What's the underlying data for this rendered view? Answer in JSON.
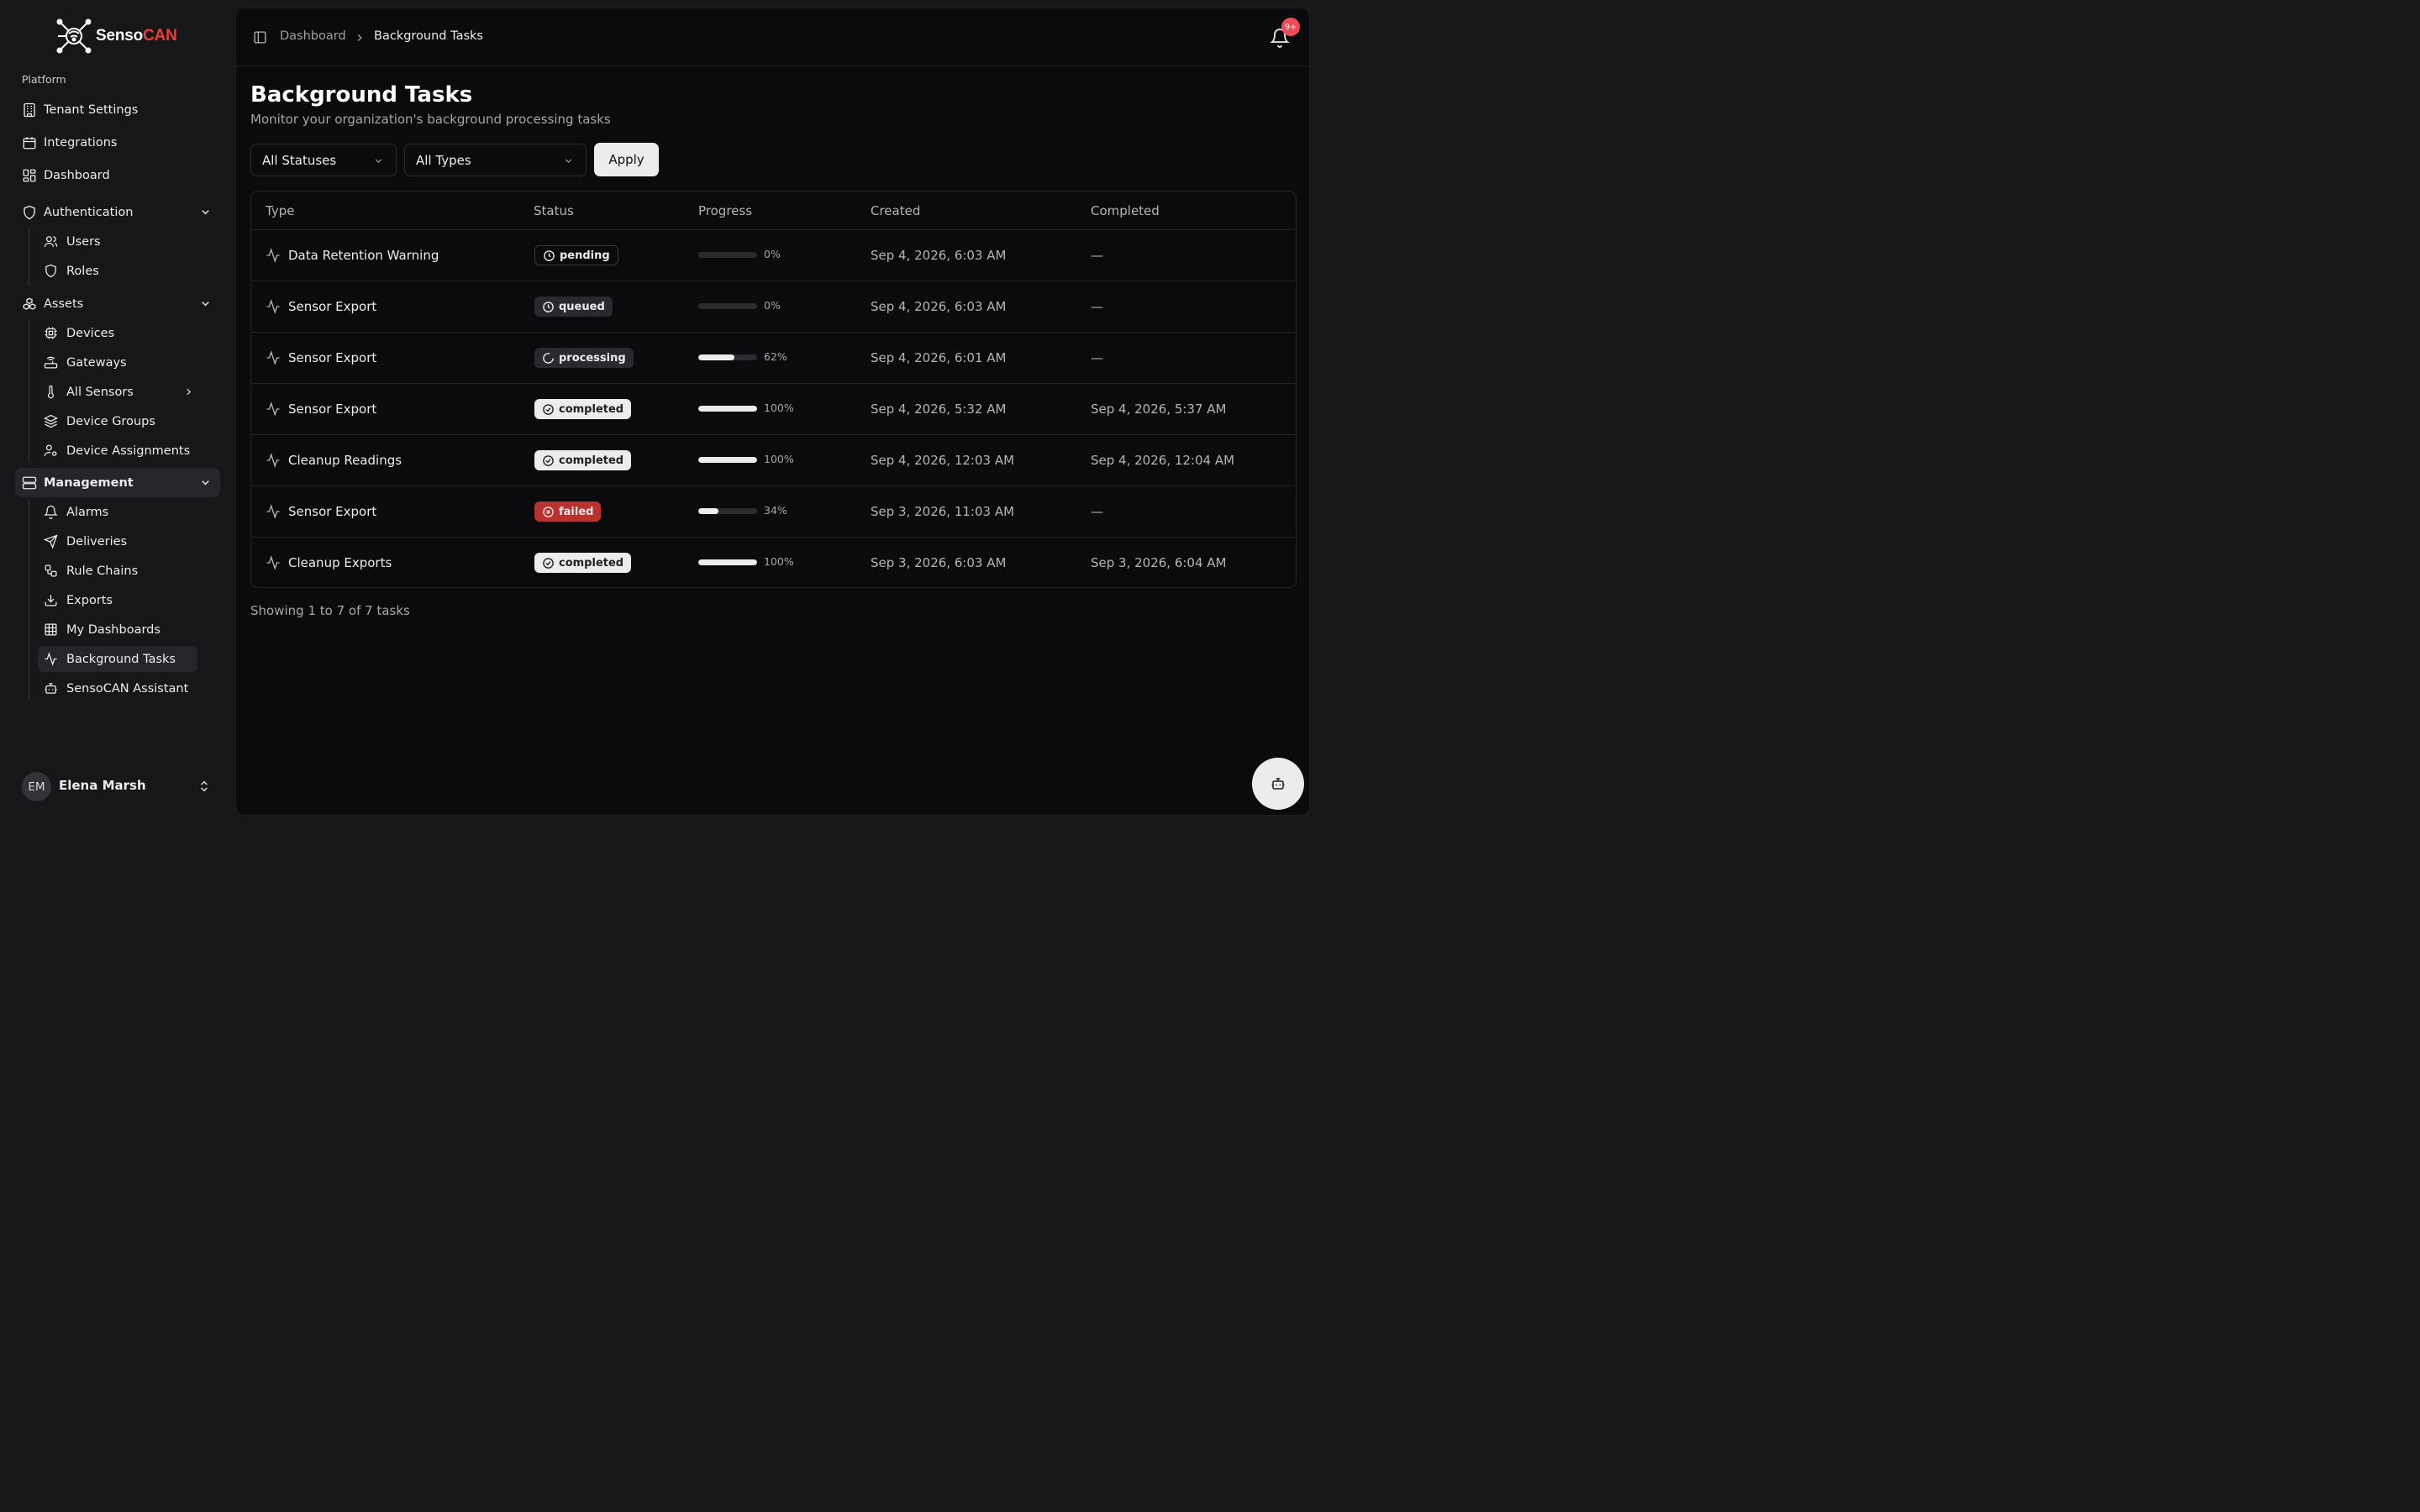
{
  "app": {
    "logo_part1": "Senso",
    "logo_part2": "CAN",
    "brand_color": "#ef3b3b"
  },
  "sidebar": {
    "group_label": "Platform",
    "top_items": [
      {
        "label": "Tenant Settings",
        "icon": "building-icon"
      },
      {
        "label": "Integrations",
        "icon": "calendar-icon"
      },
      {
        "label": "Dashboard",
        "icon": "dashboard-icon"
      }
    ],
    "authentication": {
      "label": "Authentication",
      "icon": "shield-icon",
      "children": [
        {
          "label": "Users",
          "icon": "users-icon"
        },
        {
          "label": "Roles",
          "icon": "shield-icon"
        }
      ]
    },
    "assets": {
      "label": "Assets",
      "icon": "boxes-icon",
      "children": [
        {
          "label": "Devices",
          "icon": "cpu-icon"
        },
        {
          "label": "Gateways",
          "icon": "router-icon"
        },
        {
          "label": "All Sensors",
          "icon": "thermometer-icon"
        },
        {
          "label": "Device Groups",
          "icon": "layers-icon"
        },
        {
          "label": "Device Assignments",
          "icon": "user-cog-icon"
        }
      ]
    },
    "management": {
      "label": "Management",
      "icon": "server-icon",
      "children": [
        {
          "label": "Alarms",
          "icon": "bell-icon"
        },
        {
          "label": "Deliveries",
          "icon": "send-icon"
        },
        {
          "label": "Rule Chains",
          "icon": "workflow-icon"
        },
        {
          "label": "Exports",
          "icon": "download-icon"
        },
        {
          "label": "My Dashboards",
          "icon": "grid-icon"
        },
        {
          "label": "Background Tasks",
          "icon": "activity-icon"
        },
        {
          "label": "SensoCAN Assistant",
          "icon": "bot-icon"
        }
      ]
    },
    "user": {
      "initials": "EM",
      "name": "Elena Marsh"
    }
  },
  "header": {
    "breadcrumb": [
      "Dashboard",
      "Background Tasks"
    ],
    "notification_badge": "9+",
    "badge_color": "#ef4a55"
  },
  "page": {
    "title": "Background Tasks",
    "subtitle": "Monitor your organization's background processing tasks",
    "filters": {
      "status_value": "All Statuses",
      "type_value": "All Types",
      "apply_label": "Apply"
    },
    "table": {
      "columns": [
        "Type",
        "Status",
        "Progress",
        "Created",
        "Completed"
      ],
      "rows": [
        {
          "type": "Data Retention Warning",
          "status": "pending",
          "progress": 0,
          "progress_label": "0%",
          "created": "Sep 4, 2026, 6:03 AM",
          "completed": "—"
        },
        {
          "type": "Sensor Export",
          "status": "queued",
          "progress": 0,
          "progress_label": "0%",
          "created": "Sep 4, 2026, 6:03 AM",
          "completed": "—"
        },
        {
          "type": "Sensor Export",
          "status": "processing",
          "progress": 62,
          "progress_label": "62%",
          "created": "Sep 4, 2026, 6:01 AM",
          "completed": "—"
        },
        {
          "type": "Sensor Export",
          "status": "completed",
          "progress": 100,
          "progress_label": "100%",
          "created": "Sep 4, 2026, 5:32 AM",
          "completed": "Sep 4, 2026, 5:37 AM"
        },
        {
          "type": "Cleanup Readings",
          "status": "completed",
          "progress": 100,
          "progress_label": "100%",
          "created": "Sep 4, 2026, 12:03 AM",
          "completed": "Sep 4, 2026, 12:04 AM"
        },
        {
          "type": "Sensor Export",
          "status": "failed",
          "progress": 34,
          "progress_label": "34%",
          "created": "Sep 3, 2026, 11:03 AM",
          "completed": "—"
        },
        {
          "type": "Cleanup Exports",
          "status": "completed",
          "progress": 100,
          "progress_label": "100%",
          "created": "Sep 3, 2026, 6:03 AM",
          "completed": "Sep 3, 2026, 6:04 AM"
        }
      ]
    },
    "footer": "Showing 1 to 7 of 7 tasks"
  },
  "fab": {
    "icon": "bot-icon"
  }
}
